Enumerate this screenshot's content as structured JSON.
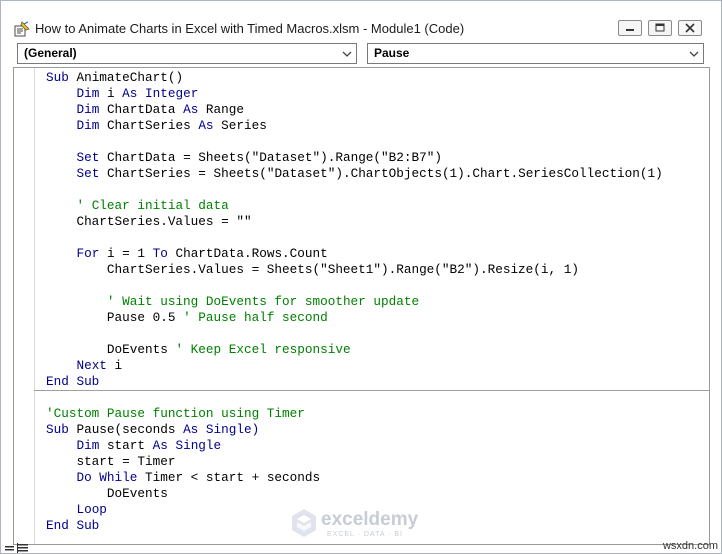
{
  "window": {
    "title": "How to Animate Charts in Excel with Timed Macros.xlsm - Module1 (Code)",
    "icon": "vba-module-icon"
  },
  "controls": {
    "minimize": "minimize-icon",
    "maximize": "maximize-icon",
    "close": "close-icon"
  },
  "object_dropdown": {
    "value": "(General)"
  },
  "procedure_dropdown": {
    "value": "Pause"
  },
  "code": [
    [
      {
        "t": "Sub ",
        "k": "kw"
      },
      {
        "t": "AnimateChart()"
      }
    ],
    [
      {
        "t": "    "
      },
      {
        "t": "Dim ",
        "k": "kw"
      },
      {
        "t": "i "
      },
      {
        "t": "As Integer",
        "k": "kw"
      }
    ],
    [
      {
        "t": "    "
      },
      {
        "t": "Dim ",
        "k": "kw"
      },
      {
        "t": "ChartData "
      },
      {
        "t": "As ",
        "k": "kw"
      },
      {
        "t": "Range"
      }
    ],
    [
      {
        "t": "    "
      },
      {
        "t": "Dim ",
        "k": "kw"
      },
      {
        "t": "ChartSeries "
      },
      {
        "t": "As ",
        "k": "kw"
      },
      {
        "t": "Series"
      }
    ],
    [],
    [
      {
        "t": "    "
      },
      {
        "t": "Set ",
        "k": "kw"
      },
      {
        "t": "ChartData = Sheets(\"Dataset\").Range(\"B2:B7\")"
      }
    ],
    [
      {
        "t": "    "
      },
      {
        "t": "Set ",
        "k": "kw"
      },
      {
        "t": "ChartSeries = Sheets(\"Dataset\").ChartObjects(1).Chart.SeriesCollection(1)"
      }
    ],
    [],
    [
      {
        "t": "    "
      },
      {
        "t": "' Clear initial data",
        "k": "cm"
      }
    ],
    [
      {
        "t": "    ChartSeries.Values = \"\""
      }
    ],
    [],
    [
      {
        "t": "    "
      },
      {
        "t": "For ",
        "k": "kw"
      },
      {
        "t": "i = 1 "
      },
      {
        "t": "To ",
        "k": "kw"
      },
      {
        "t": "ChartData.Rows.Count"
      }
    ],
    [
      {
        "t": "        ChartSeries.Values = Sheets(\"Sheet1\").Range(\"B2\").Resize(i, 1)"
      }
    ],
    [],
    [
      {
        "t": "        "
      },
      {
        "t": "' Wait using DoEvents for smoother update",
        "k": "cm"
      }
    ],
    [
      {
        "t": "        Pause 0.5 "
      },
      {
        "t": "' Pause half second",
        "k": "cm"
      }
    ],
    [],
    [
      {
        "t": "        DoEvents "
      },
      {
        "t": "' Keep Excel responsive",
        "k": "cm"
      }
    ],
    [
      {
        "t": "    "
      },
      {
        "t": "Next ",
        "k": "kw"
      },
      {
        "t": "i"
      }
    ],
    [
      {
        "t": "End Sub",
        "k": "kw"
      }
    ],
    [],
    [
      {
        "t": "'Custom Pause function using Timer",
        "k": "cm"
      }
    ],
    [
      {
        "t": "Sub ",
        "k": "kw"
      },
      {
        "t": "Pause(seconds "
      },
      {
        "t": "As ",
        "k": "kw"
      },
      {
        "t": "Single)",
        "k": "kw"
      }
    ],
    [
      {
        "t": "    "
      },
      {
        "t": "Dim ",
        "k": "kw"
      },
      {
        "t": "start "
      },
      {
        "t": "As Single",
        "k": "kw"
      }
    ],
    [
      {
        "t": "    start = Timer"
      }
    ],
    [
      {
        "t": "    "
      },
      {
        "t": "Do While ",
        "k": "kw"
      },
      {
        "t": "Timer < start + seconds"
      }
    ],
    [
      {
        "t": "        DoEvents"
      }
    ],
    [
      {
        "t": "    "
      },
      {
        "t": "Loop",
        "k": "kw"
      }
    ],
    [
      {
        "t": "End Sub",
        "k": "kw"
      }
    ]
  ],
  "watermark": {
    "name": "exceldemy",
    "tagline": "EXCEL · DATA · BI"
  },
  "credit": "wsxdn.com",
  "colors": {
    "keyword": "#00008b",
    "comment": "#008000",
    "text": "#000000"
  }
}
